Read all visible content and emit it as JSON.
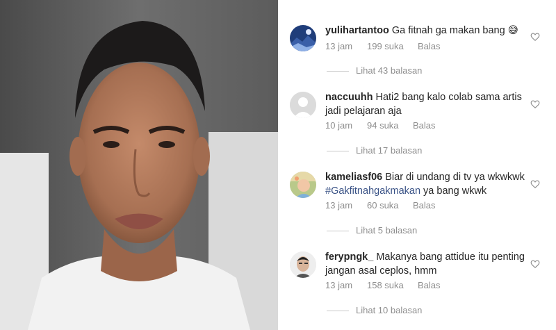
{
  "comments": [
    {
      "username": "yulihartantoo",
      "text": "Ga fitnah ga makan bang 😅",
      "hashtag": "",
      "text_after": "",
      "time": "13 jam",
      "likes": "199 suka",
      "reply_label": "Balas",
      "view_replies": "Lihat 43 balasan",
      "avatar_icon": "landscape-avatar-icon"
    },
    {
      "username": "naccuuhh",
      "text": "Hati2 bang kalo colab sama artis jadi pelajaran aja",
      "hashtag": "",
      "text_after": "",
      "time": "10 jam",
      "likes": "94 suka",
      "reply_label": "Balas",
      "view_replies": "Lihat 17 balasan",
      "avatar_icon": "default-user-avatar-icon"
    },
    {
      "username": "kameliasf06",
      "text": "Biar di undang di tv ya wkwkwk ",
      "hashtag": "#Gakfitnahgakmakan",
      "text_after": " ya bang wkwk",
      "time": "13 jam",
      "likes": "60 suka",
      "reply_label": "Balas",
      "view_replies": "Lihat 5 balasan",
      "avatar_icon": "baby-photo-avatar-icon"
    },
    {
      "username": "ferypngk_",
      "text": "Makanya bang attidue itu penting jangan asal ceplos, hmm",
      "hashtag": "",
      "text_after": "",
      "time": "13 jam",
      "likes": "158 suka",
      "reply_label": "Balas",
      "view_replies": "Lihat 10 balasan",
      "avatar_icon": "man-face-avatar-icon"
    }
  ],
  "colors": {
    "text": "#262626",
    "secondary": "#8e8e8e",
    "hashtag": "#385185"
  }
}
